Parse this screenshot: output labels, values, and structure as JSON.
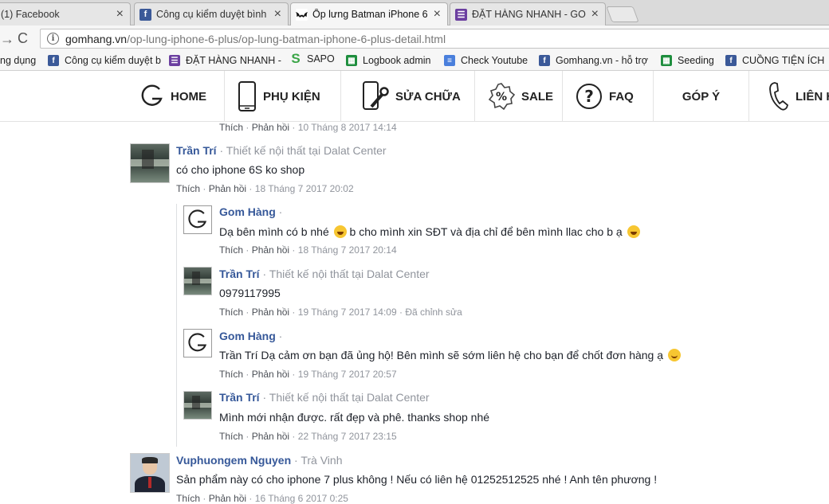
{
  "browser": {
    "tabs": [
      {
        "title": "(1) Facebook",
        "icon": "facebook-icon"
      },
      {
        "title": "Công cụ kiểm duyệt bình",
        "icon": "facebook-icon"
      },
      {
        "title": "Ốp lưng Batman iPhone 6",
        "icon": "batman-icon"
      },
      {
        "title": "ĐẶT HÀNG NHANH - GO",
        "icon": "google-forms-icon"
      }
    ],
    "url_host": "gomhang.vn",
    "url_path": "/op-lung-iphone-6-plus/op-lung-batman-iphone-6-plus-detail.html",
    "bookmarks": [
      {
        "label": "ng dụng",
        "icon": "none"
      },
      {
        "label": "Công cụ kiểm duyệt b",
        "icon": "facebook-icon"
      },
      {
        "label": "ĐẶT HÀNG NHANH -",
        "icon": "google-forms-icon"
      },
      {
        "label": "SAPO",
        "icon": "sapo-icon"
      },
      {
        "label": "Logbook admin",
        "icon": "sheets-icon"
      },
      {
        "label": "Check Youtube",
        "icon": "docs-icon"
      },
      {
        "label": "Gomhang.vn - hỗ trợ",
        "icon": "facebook-icon"
      },
      {
        "label": "Seeding",
        "icon": "sheets-icon"
      },
      {
        "label": "CUỒNG TIỆN ÍCH",
        "icon": "facebook-icon"
      }
    ]
  },
  "site_nav": {
    "home": "HOME",
    "accessories": "PHỤ KIỆN",
    "repair": "SỬA CHỮA",
    "sale": "SALE",
    "faq": "FAQ",
    "feedback": "GÓP Ý",
    "contact": "LIÊN H"
  },
  "actions": {
    "like": "Thích",
    "reply": "Phản hồi",
    "separator": "·"
  },
  "comments": {
    "top_meta": {
      "time": "10 Tháng 8 2017 14:14"
    },
    "c1": {
      "author": "Trần Trí",
      "subtitle": "· Thiết kế nội thất tại Dalat Center",
      "text": "có cho iphone 6S ko shop",
      "time": "18 Tháng 7 2017 20:02"
    },
    "r1": {
      "author": "Gom Hàng",
      "subtitle": "·",
      "text": "Dạ bên mình có b nhé",
      "text2": " b cho mình xin SĐT và địa chỉ để bên mình llac cho b ạ",
      "time": "18 Tháng 7 2017 20:14"
    },
    "r2": {
      "author": "Trần Trí",
      "subtitle": "· Thiết kế nội thất tại Dalat Center",
      "text": "0979117995",
      "time": "19 Tháng 7 2017 14:09",
      "edited": "Đã chỉnh sửa"
    },
    "r3": {
      "author": "Gom Hàng",
      "subtitle": "·",
      "text": "Trần Trí Dạ cảm ơn bạn đã ủng hộ! Bên mình sẽ sớm liên hệ cho bạn để chốt đơn hàng ạ",
      "time": "19 Tháng 7 2017 20:57"
    },
    "r4": {
      "author": "Trần Trí",
      "subtitle": "· Thiết kế nội thất tại Dalat Center",
      "text": "Mình mới nhận được. rất đẹp và phê. thanks shop nhé",
      "time": "22 Tháng 7 2017 23:15"
    },
    "c2": {
      "author": "Vuphuongem Nguyen",
      "subtitle": "· Trà Vinh",
      "text": "Sản phẩm này có cho iphone 7 plus không ! Nếu có liên hệ 01252512525 nhé ! Anh tên phương !",
      "time": "16 Tháng 6 2017 0:25"
    }
  },
  "colors": {
    "author": "#365899",
    "meta": "#90949c",
    "text": "#1d2129"
  }
}
